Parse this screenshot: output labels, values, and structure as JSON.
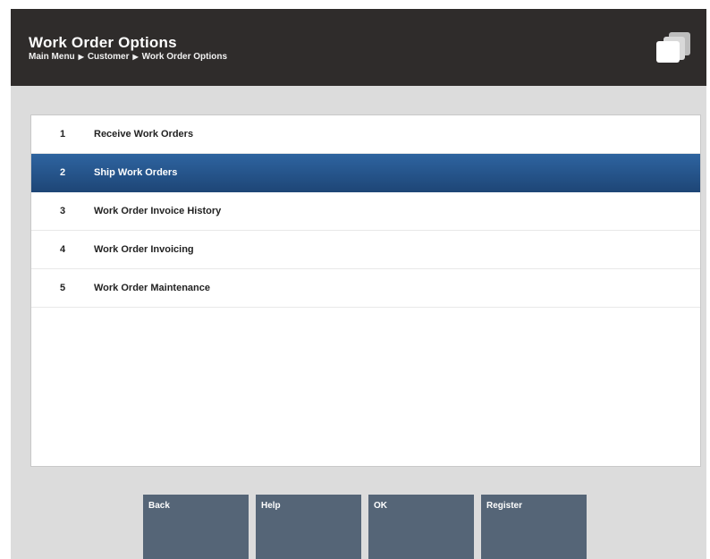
{
  "header": {
    "title": "Work Order Options",
    "breadcrumb": [
      "Main Menu",
      "Customer",
      "Work Order Options"
    ]
  },
  "menu": {
    "selected_index": 1,
    "items": [
      {
        "number": "1",
        "label": "Receive Work Orders"
      },
      {
        "number": "2",
        "label": "Ship Work Orders"
      },
      {
        "number": "3",
        "label": "Work Order Invoice History"
      },
      {
        "number": "4",
        "label": "Work Order Invoicing"
      },
      {
        "number": "5",
        "label": "Work Order Maintenance"
      }
    ]
  },
  "buttons": {
    "back": "Back",
    "help": "Help",
    "ok": "OK",
    "register": "Register"
  },
  "colors": {
    "header_bg": "#2f2c2b",
    "selected_row": "#245283",
    "button_bg": "#556577"
  }
}
